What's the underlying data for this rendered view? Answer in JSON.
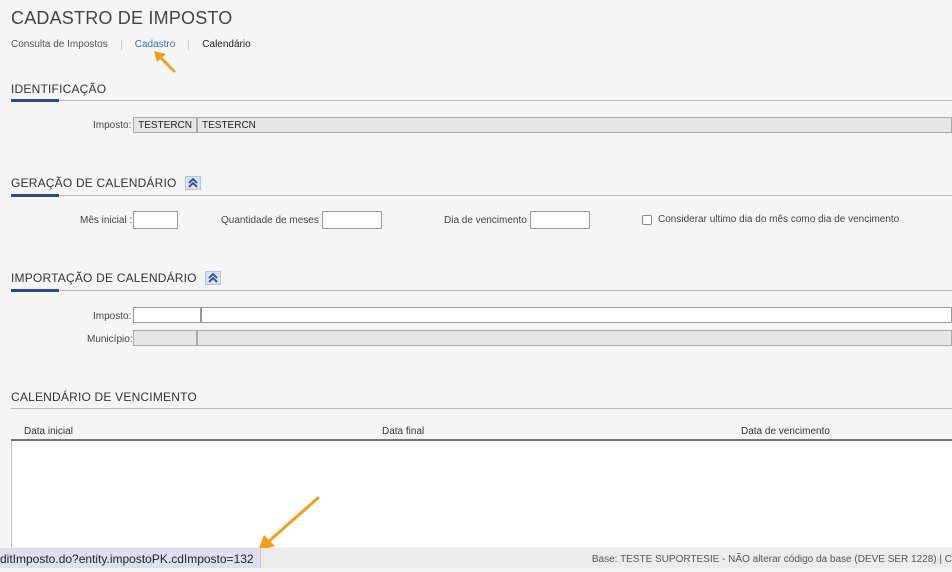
{
  "page": {
    "title": "CADASTRO DE IMPOSTO"
  },
  "tabs": [
    {
      "label": "Consulta de Impostos"
    },
    {
      "label": "Cadastro"
    },
    {
      "label": "Calendário"
    }
  ],
  "identificacao": {
    "title": "IDENTIFICAÇÃO",
    "imposto_label": "Imposto:",
    "imposto_code": "TESTERCN",
    "imposto_name": "TESTERCN"
  },
  "geracao": {
    "title": "GERAÇÃO DE CALENDÁRIO",
    "mes_inicial_label": "Mês inicial :",
    "mes_inicial_value": "",
    "qtd_meses_label": "Quantidade de meses :",
    "qtd_meses_value": "",
    "dia_venc_label": "Dia de vencimento :",
    "dia_venc_value": "",
    "checkbox_label": "Considerar ultimo dia do mês como dia de vencimento",
    "checkbox_checked": false
  },
  "importacao": {
    "title": "IMPORTAÇÃO DE CALENDÁRIO",
    "imposto_label": "Imposto:",
    "imposto_code": "",
    "imposto_name": "",
    "municipio_label": "Município:",
    "municipio_code": "",
    "municipio_name": ""
  },
  "calendario": {
    "title": "CALENDÁRIO DE VENCIMENTO",
    "columns": [
      "Data inicial",
      "Data final",
      "Data de vencimento"
    ],
    "rows": []
  },
  "status": {
    "url": "ditImposto.do?entity.impostoPK.cdImposto=132",
    "base": "Base: TESTE SUPORTESIE - NÃO alterar código da base (DEVE SER 1228)  | C"
  },
  "colors": {
    "accent": "#2d4a8a",
    "link": "#3a6ea5",
    "annotation_arrow": "#f0a020"
  }
}
